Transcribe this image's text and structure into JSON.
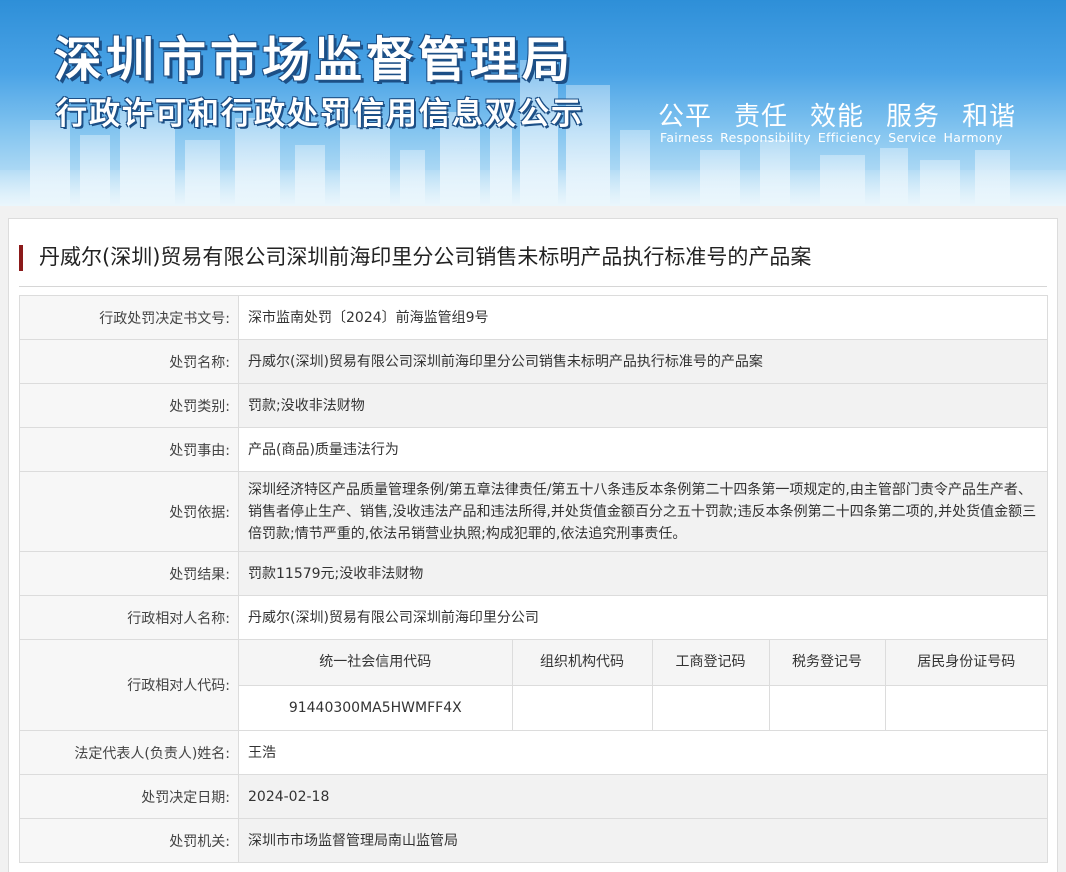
{
  "banner": {
    "title": "深圳市市场监督管理局",
    "subtitle": "行政许可和行政处罚信用信息双公示",
    "slogans_cn": [
      "公平",
      "责任",
      "效能",
      "服务",
      "和谐"
    ],
    "slogans_en": [
      "Fairness",
      "Responsibility",
      "Efficiency",
      "Service",
      "Harmony"
    ]
  },
  "case": {
    "title": "丹威尔(深圳)贸易有限公司深圳前海印里分公司销售未标明产品执行标准号的产品案"
  },
  "fields": [
    {
      "label": "行政处罚决定书文号:",
      "value": "深市监南处罚〔2024〕前海监管组9号"
    },
    {
      "label": "处罚名称:",
      "value": "丹威尔(深圳)贸易有限公司深圳前海印里分公司销售未标明产品执行标准号的产品案"
    },
    {
      "label": "处罚类别:",
      "value": "罚款;没收非法财物"
    },
    {
      "label": "处罚事由:",
      "value": "产品(商品)质量违法行为"
    },
    {
      "label": "处罚依据:",
      "value": "深圳经济特区产品质量管理条例/第五章法律责任/第五十八条违反本条例第二十四条第一项规定的,由主管部门责令产品生产者、销售者停止生产、销售,没收违法产品和违法所得,并处货值金额百分之五十罚款;违反本条例第二十四条第二项的,并处货值金额三倍罚款;情节严重的,依法吊销营业执照;构成犯罪的,依法追究刑事责任。"
    },
    {
      "label": "处罚结果:",
      "value": "罚款11579元;没收非法财物"
    },
    {
      "label": "行政相对人名称:",
      "value": "丹威尔(深圳)贸易有限公司深圳前海印里分公司"
    },
    {
      "label": "行政相对人代码:",
      "value": ""
    },
    {
      "label": "法定代表人(负责人)姓名:",
      "value": "王浩"
    },
    {
      "label": "处罚决定日期:",
      "value": "2024-02-18"
    },
    {
      "label": "处罚机关:",
      "value": "深圳市市场监督管理局南山监管局"
    }
  ],
  "codes": {
    "headers": [
      "统一社会信用代码",
      "组织机构代码",
      "工商登记码",
      "税务登记号",
      "居民身份证号码"
    ],
    "values": [
      "91440300MA5HWMFF4X",
      "",
      "",
      "",
      ""
    ]
  }
}
